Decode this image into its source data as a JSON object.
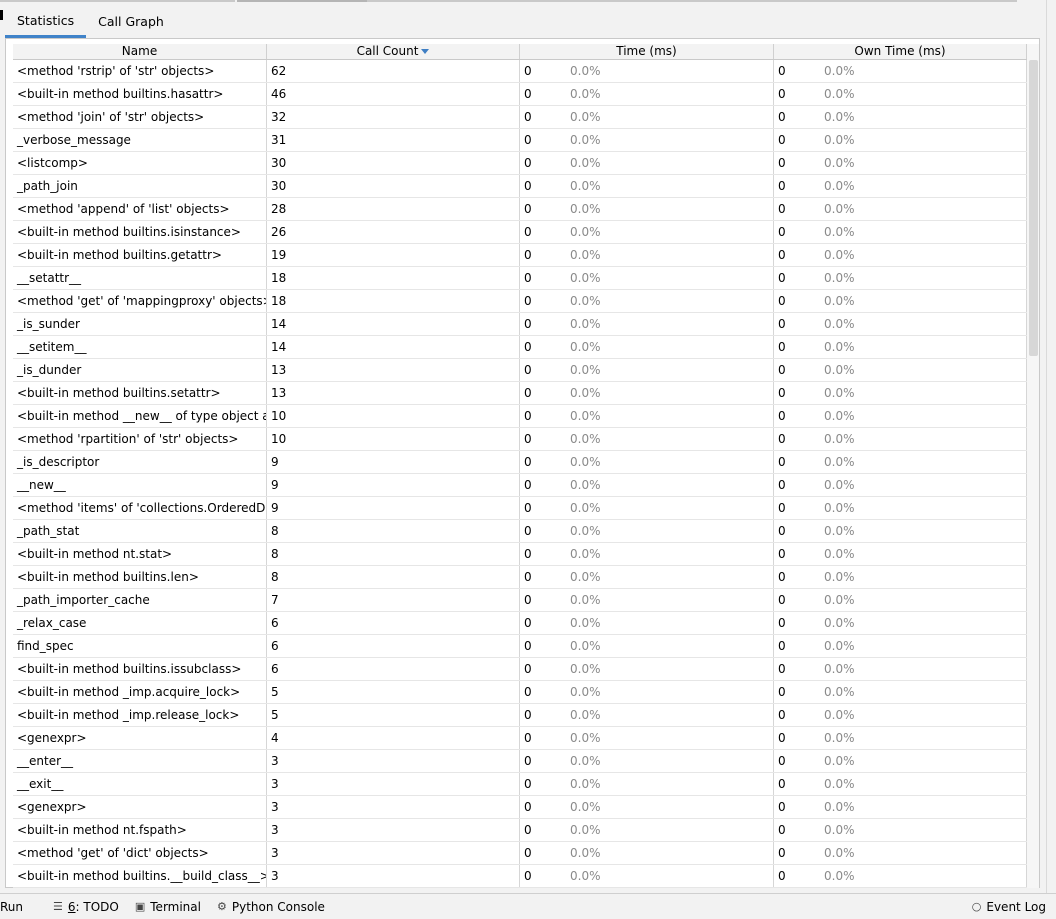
{
  "tabs": [
    {
      "label": "Statistics",
      "active": true
    },
    {
      "label": "Call Graph",
      "active": false
    }
  ],
  "table": {
    "columns": [
      "Name",
      "Call Count",
      "Time (ms)",
      "Own Time (ms)"
    ],
    "sorted_column": "Call Count",
    "sort_direction": "descending",
    "rows": [
      {
        "name": "<method 'rstrip' of 'str' objects>",
        "count": "62",
        "time": "0",
        "time_pct": "0.0%",
        "own": "0",
        "own_pct": "0.0%"
      },
      {
        "name": "<built-in method builtins.hasattr>",
        "count": "46",
        "time": "0",
        "time_pct": "0.0%",
        "own": "0",
        "own_pct": "0.0%"
      },
      {
        "name": "<method 'join' of 'str' objects>",
        "count": "32",
        "time": "0",
        "time_pct": "0.0%",
        "own": "0",
        "own_pct": "0.0%"
      },
      {
        "name": "_verbose_message",
        "count": "31",
        "time": "0",
        "time_pct": "0.0%",
        "own": "0",
        "own_pct": "0.0%"
      },
      {
        "name": "<listcomp>",
        "count": "30",
        "time": "0",
        "time_pct": "0.0%",
        "own": "0",
        "own_pct": "0.0%"
      },
      {
        "name": "_path_join",
        "count": "30",
        "time": "0",
        "time_pct": "0.0%",
        "own": "0",
        "own_pct": "0.0%"
      },
      {
        "name": "<method 'append' of 'list' objects>",
        "count": "28",
        "time": "0",
        "time_pct": "0.0%",
        "own": "0",
        "own_pct": "0.0%"
      },
      {
        "name": "<built-in method builtins.isinstance>",
        "count": "26",
        "time": "0",
        "time_pct": "0.0%",
        "own": "0",
        "own_pct": "0.0%"
      },
      {
        "name": "<built-in method builtins.getattr>",
        "count": "19",
        "time": "0",
        "time_pct": "0.0%",
        "own": "0",
        "own_pct": "0.0%"
      },
      {
        "name": "__setattr__",
        "count": "18",
        "time": "0",
        "time_pct": "0.0%",
        "own": "0",
        "own_pct": "0.0%"
      },
      {
        "name": "<method 'get' of 'mappingproxy' objects>",
        "count": "18",
        "time": "0",
        "time_pct": "0.0%",
        "own": "0",
        "own_pct": "0.0%"
      },
      {
        "name": "_is_sunder",
        "count": "14",
        "time": "0",
        "time_pct": "0.0%",
        "own": "0",
        "own_pct": "0.0%"
      },
      {
        "name": "__setitem__",
        "count": "14",
        "time": "0",
        "time_pct": "0.0%",
        "own": "0",
        "own_pct": "0.0%"
      },
      {
        "name": "_is_dunder",
        "count": "13",
        "time": "0",
        "time_pct": "0.0%",
        "own": "0",
        "own_pct": "0.0%"
      },
      {
        "name": "<built-in method builtins.setattr>",
        "count": "13",
        "time": "0",
        "time_pct": "0.0%",
        "own": "0",
        "own_pct": "0.0%"
      },
      {
        "name": "<built-in method __new__ of type object at",
        "count": "10",
        "time": "0",
        "time_pct": "0.0%",
        "own": "0",
        "own_pct": "0.0%"
      },
      {
        "name": "<method 'rpartition' of 'str' objects>",
        "count": "10",
        "time": "0",
        "time_pct": "0.0%",
        "own": "0",
        "own_pct": "0.0%"
      },
      {
        "name": "_is_descriptor",
        "count": "9",
        "time": "0",
        "time_pct": "0.0%",
        "own": "0",
        "own_pct": "0.0%"
      },
      {
        "name": "__new__",
        "count": "9",
        "time": "0",
        "time_pct": "0.0%",
        "own": "0",
        "own_pct": "0.0%"
      },
      {
        "name": "<method 'items' of 'collections.OrderedDic",
        "count": "9",
        "time": "0",
        "time_pct": "0.0%",
        "own": "0",
        "own_pct": "0.0%"
      },
      {
        "name": "_path_stat",
        "count": "8",
        "time": "0",
        "time_pct": "0.0%",
        "own": "0",
        "own_pct": "0.0%"
      },
      {
        "name": "<built-in method nt.stat>",
        "count": "8",
        "time": "0",
        "time_pct": "0.0%",
        "own": "0",
        "own_pct": "0.0%"
      },
      {
        "name": "<built-in method builtins.len>",
        "count": "8",
        "time": "0",
        "time_pct": "0.0%",
        "own": "0",
        "own_pct": "0.0%"
      },
      {
        "name": "_path_importer_cache",
        "count": "7",
        "time": "0",
        "time_pct": "0.0%",
        "own": "0",
        "own_pct": "0.0%"
      },
      {
        "name": "_relax_case",
        "count": "6",
        "time": "0",
        "time_pct": "0.0%",
        "own": "0",
        "own_pct": "0.0%"
      },
      {
        "name": "find_spec",
        "count": "6",
        "time": "0",
        "time_pct": "0.0%",
        "own": "0",
        "own_pct": "0.0%"
      },
      {
        "name": "<built-in method builtins.issubclass>",
        "count": "6",
        "time": "0",
        "time_pct": "0.0%",
        "own": "0",
        "own_pct": "0.0%"
      },
      {
        "name": "<built-in method _imp.acquire_lock>",
        "count": "5",
        "time": "0",
        "time_pct": "0.0%",
        "own": "0",
        "own_pct": "0.0%"
      },
      {
        "name": "<built-in method _imp.release_lock>",
        "count": "5",
        "time": "0",
        "time_pct": "0.0%",
        "own": "0",
        "own_pct": "0.0%"
      },
      {
        "name": "<genexpr>",
        "count": "4",
        "time": "0",
        "time_pct": "0.0%",
        "own": "0",
        "own_pct": "0.0%"
      },
      {
        "name": "__enter__",
        "count": "3",
        "time": "0",
        "time_pct": "0.0%",
        "own": "0",
        "own_pct": "0.0%"
      },
      {
        "name": "__exit__",
        "count": "3",
        "time": "0",
        "time_pct": "0.0%",
        "own": "0",
        "own_pct": "0.0%"
      },
      {
        "name": "<genexpr>",
        "count": "3",
        "time": "0",
        "time_pct": "0.0%",
        "own": "0",
        "own_pct": "0.0%"
      },
      {
        "name": "<built-in method nt.fspath>",
        "count": "3",
        "time": "0",
        "time_pct": "0.0%",
        "own": "0",
        "own_pct": "0.0%"
      },
      {
        "name": "<method 'get' of 'dict' objects>",
        "count": "3",
        "time": "0",
        "time_pct": "0.0%",
        "own": "0",
        "own_pct": "0.0%"
      },
      {
        "name": "<built-in method builtins.__build_class__>",
        "count": "3",
        "time": "0",
        "time_pct": "0.0%",
        "own": "0",
        "own_pct": "0.0%"
      }
    ]
  },
  "statusbar": {
    "run": "Run",
    "todo_num": "6",
    "todo_rest": ": TODO",
    "terminal": "Terminal",
    "python_console": "Python Console",
    "event_log": "Event Log"
  },
  "icons": {
    "todo": "list-icon",
    "terminal": "terminal-icon",
    "python_console": "python-icon",
    "event_log": "speech-bubble-icon"
  },
  "colors": {
    "accent": "#4083c9",
    "percent_text": "#8a8a8a"
  }
}
